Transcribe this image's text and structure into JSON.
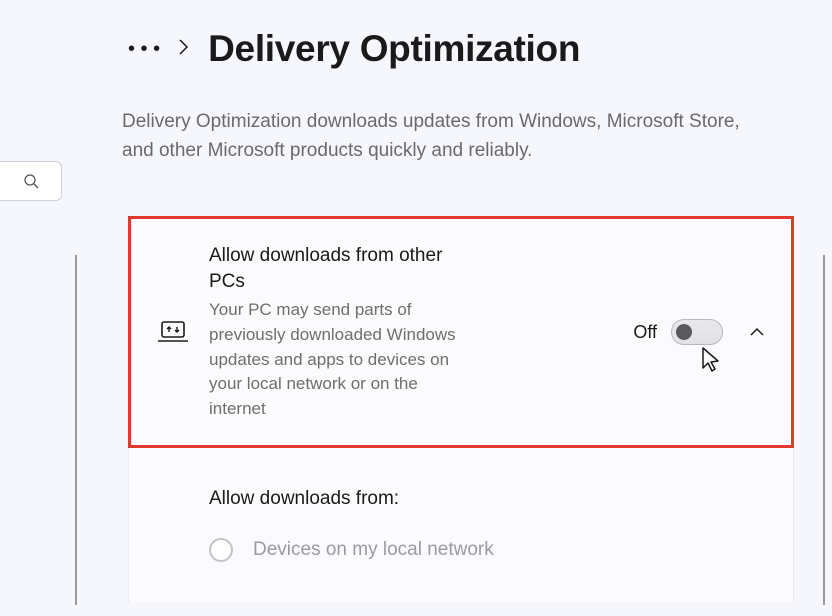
{
  "header": {
    "title": "Delivery Optimization",
    "description": "Delivery Optimization downloads updates from Windows, Microsoft Store, and other Microsoft products quickly and reliably."
  },
  "card": {
    "title": "Allow downloads from other PCs",
    "subtitle": "Your PC may send parts of previously downloaded Windows updates and apps to devices on your local network or on the internet",
    "toggle_state": "Off"
  },
  "options": {
    "section_title": "Allow downloads from:",
    "radio1_label": "Devices on my local network"
  }
}
